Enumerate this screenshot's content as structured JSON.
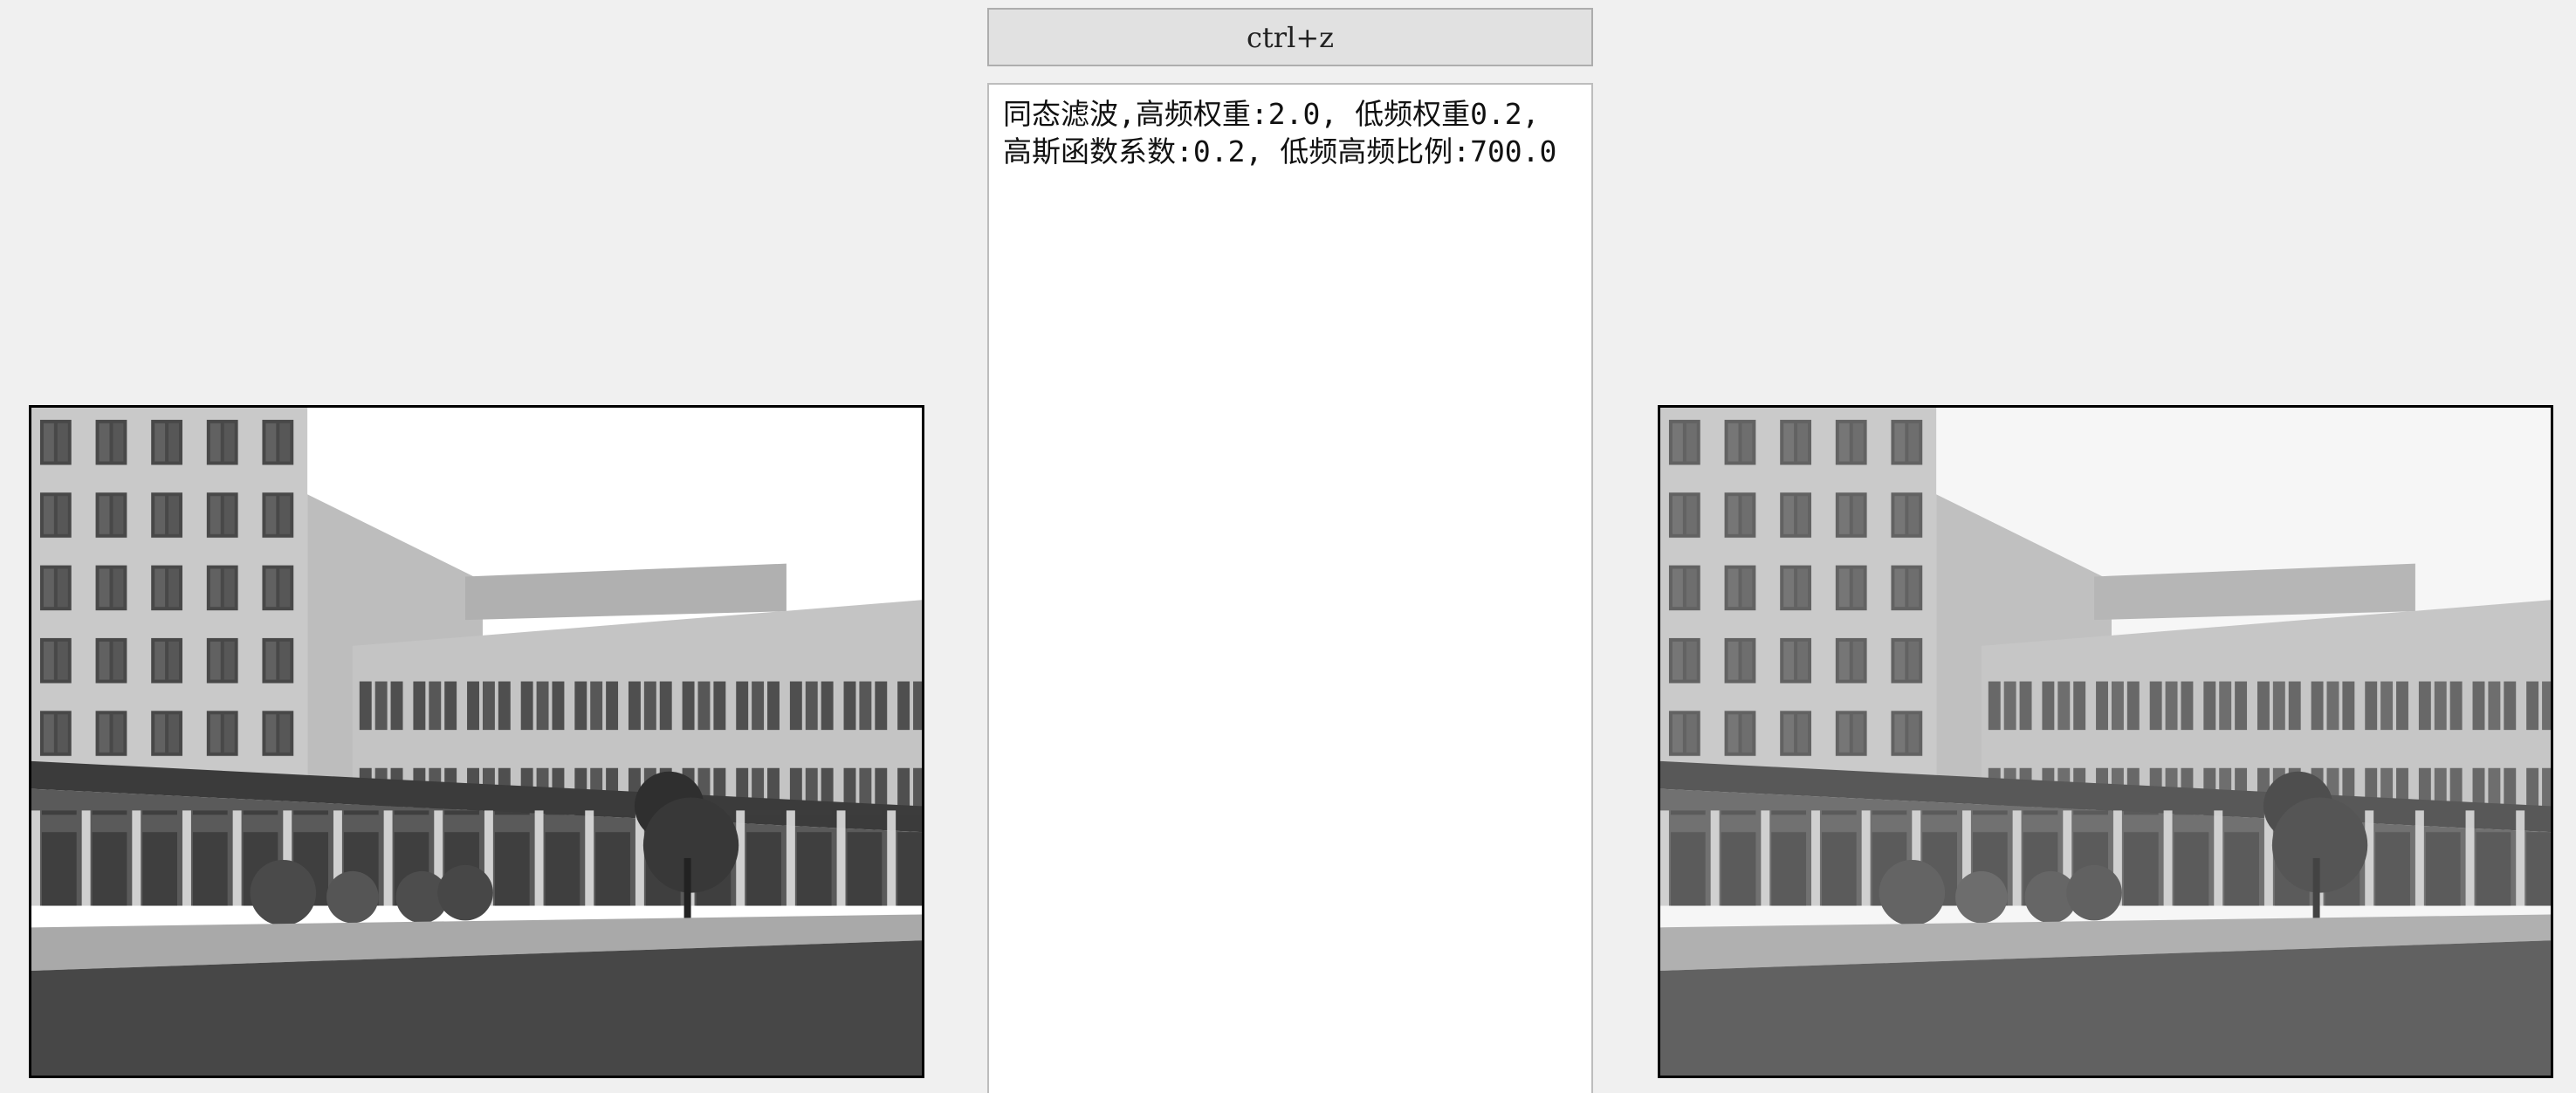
{
  "toolbar": {
    "undo_label": "ctrl+z"
  },
  "info": {
    "line1": "同态滤波,高频权重:2.0, 低频权重0.2,",
    "line2": "高斯函数系数:0.2, 低频高频比例:700.0"
  },
  "images": {
    "original": "school-building-photo",
    "filtered": "school-building-photo-homomorphic-filtered"
  }
}
